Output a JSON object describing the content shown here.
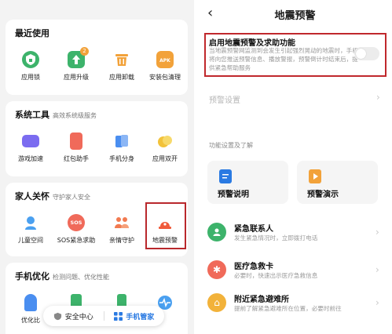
{
  "left": {
    "recent": {
      "title": "最近使用",
      "apps": [
        {
          "label": "应用锁",
          "icon": "shield-lock-icon",
          "color": "#3db36b"
        },
        {
          "label": "应用升级",
          "icon": "upgrade-arrow-icon",
          "color": "#3db36b",
          "badge": "2"
        },
        {
          "label": "应用卸载",
          "icon": "trash-icon",
          "color": "#f2a23a"
        },
        {
          "label": "安装包清理",
          "icon": "apk-package-icon",
          "color": "#f2a23a"
        }
      ]
    },
    "tools": {
      "title": "系统工具",
      "subtitle": "高效系统级服务",
      "apps": [
        {
          "label": "游戏加速",
          "icon": "gamepad-icon",
          "color": "#7b6cf0"
        },
        {
          "label": "红包助手",
          "icon": "red-envelope-icon",
          "color": "#f06a5a"
        },
        {
          "label": "手机分身",
          "icon": "phone-clone-icon",
          "color": "#4a8ef0"
        },
        {
          "label": "应用双开",
          "icon": "dual-app-icon",
          "color": "#f2c23a"
        }
      ]
    },
    "family": {
      "title": "家人关怀",
      "subtitle": "守护家人安全",
      "apps": [
        {
          "label": "儿童空间",
          "icon": "child-space-icon",
          "color": "#4aa0f0"
        },
        {
          "label": "SOS紧急求助",
          "icon": "sos-icon",
          "color": "#f06a5a",
          "text": "SOS"
        },
        {
          "label": "亲情守护",
          "icon": "family-guard-icon",
          "color": "#f27a50"
        },
        {
          "label": "地震预警",
          "icon": "earthquake-alarm-icon",
          "color": "#f05a3a"
        }
      ]
    },
    "optimize": {
      "title": "手机优化",
      "subtitle": "检测问题、优化性能",
      "apps": [
        {
          "label": "优化比",
          "icon": "rocket-icon",
          "color": "#4a8ef0"
        },
        {
          "label": "",
          "icon": "broom-icon",
          "color": "#3db36b"
        },
        {
          "label": "",
          "icon": "battery-icon",
          "color": "#3db36b"
        },
        {
          "label": "",
          "icon": "pulse-icon",
          "color": "#4aa0f0"
        }
      ]
    },
    "bottom_tabs": [
      {
        "label": "安全中心",
        "icon": "shield-icon",
        "active": false
      },
      {
        "label": "手机管家",
        "icon": "grid-icon",
        "active": true
      }
    ]
  },
  "right": {
    "title": "地震预警",
    "feature": {
      "title": "启用地震预警及求助功能",
      "desc": "当地震预警网监测到会发生引起强烈晃动的地震时，手机将向您推送预警信息、播放警报，预警倒计时结束后，提供紧急帮助服务",
      "enabled": false
    },
    "settings_label": "预警设置",
    "section_label": "功能设置及了解",
    "tiles": [
      {
        "label": "预警说明",
        "icon": "document-icon",
        "color": "#2a7ae2"
      },
      {
        "label": "预警演示",
        "icon": "play-icon",
        "color": "#f2a23a"
      }
    ],
    "items": [
      {
        "title": "紧急联系人",
        "desc": "发生紧急情况时，立即拨打电话",
        "icon": "contact-icon",
        "color": "#3db36b",
        "glyph": "●"
      },
      {
        "title": "医疗急救卡",
        "desc": "必要时，快速出示医疗急救信息",
        "icon": "medical-icon",
        "color": "#f06a5a",
        "glyph": "✱"
      },
      {
        "title": "附近紧急避难所",
        "desc": "提前了解紧急避难所在位置，必要时前往",
        "icon": "shelter-icon",
        "color": "#f2b23a",
        "glyph": "⌂"
      }
    ]
  }
}
